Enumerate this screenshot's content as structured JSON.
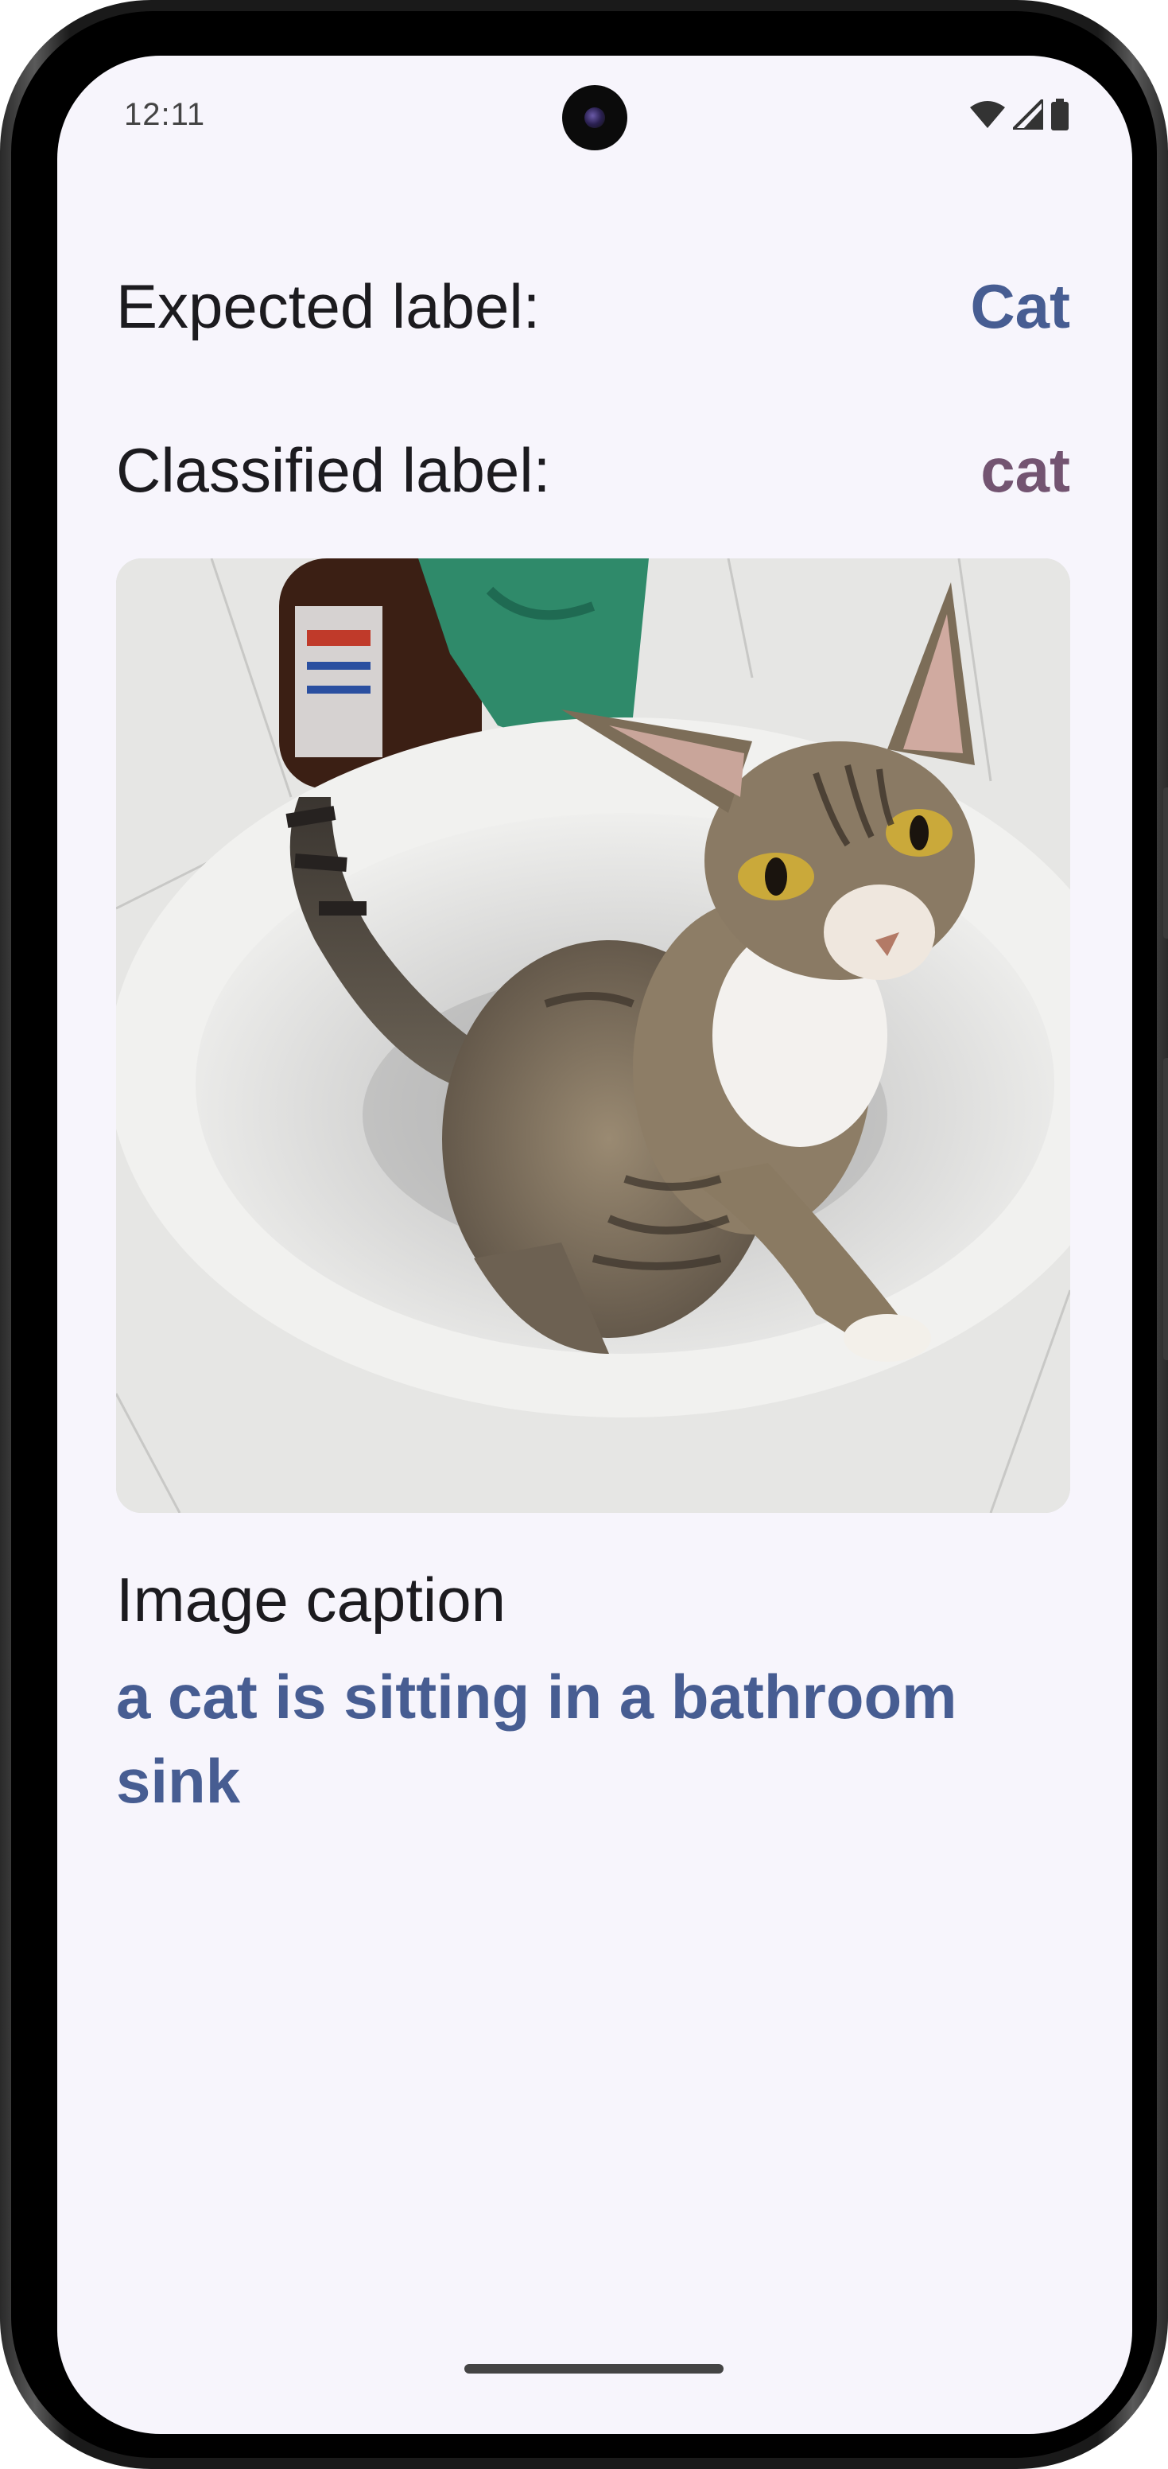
{
  "status_bar": {
    "time": "12:11",
    "icons": [
      "wifi-icon",
      "cellular-signal-icon",
      "battery-icon"
    ]
  },
  "expected": {
    "label": "Expected label:",
    "value": "Cat"
  },
  "classified": {
    "label": "Classified label:",
    "value": "cat"
  },
  "image": {
    "description_name": "cat-in-sink-photo"
  },
  "caption": {
    "title": "Image caption",
    "text": "a cat is sitting in a bathroom sink"
  },
  "colors": {
    "background": "#f7f5fc",
    "expected_value": "#475d92",
    "classified_value": "#735471",
    "text": "#1c1b1f"
  }
}
